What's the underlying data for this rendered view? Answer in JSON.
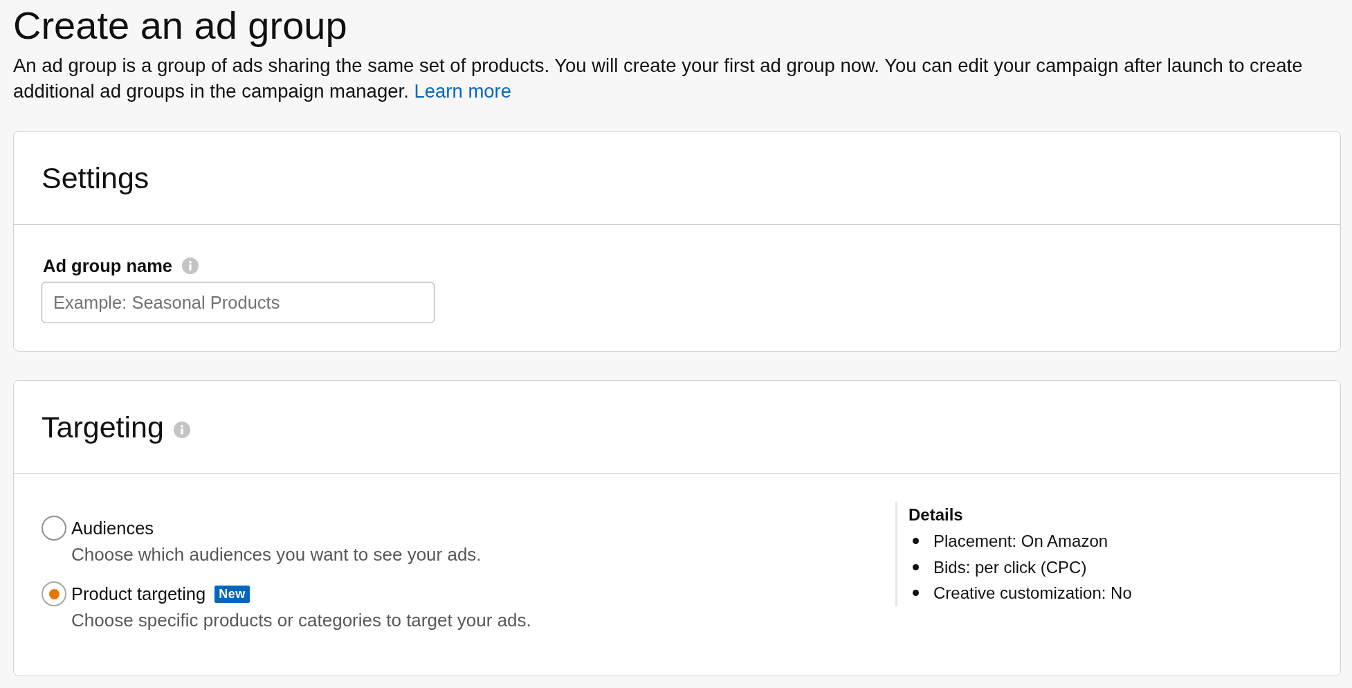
{
  "header": {
    "title": "Create an ad group",
    "description": "An ad group is a group of ads sharing the same set of products. You will create your first ad group now. You can edit your campaign after launch to create additional ad groups in the campaign manager.",
    "link": "Learn more"
  },
  "settings": {
    "title": "Settings",
    "field": {
      "label": "Ad group name",
      "placeholder": "Example: Seasonal Products"
    }
  },
  "targeting": {
    "title": "Targeting",
    "options": [
      {
        "label": "Audiences",
        "description": "Choose which audiences you want to see your ads.",
        "selected": false
      },
      {
        "label": "Product targeting",
        "badge": "New",
        "description": "Choose specific products or categories to target your ads.",
        "selected": true
      }
    ],
    "details": {
      "title": "Details",
      "items": [
        "Placement: On Amazon",
        "Bids: per click (CPC)",
        "Creative customization: No"
      ]
    }
  }
}
